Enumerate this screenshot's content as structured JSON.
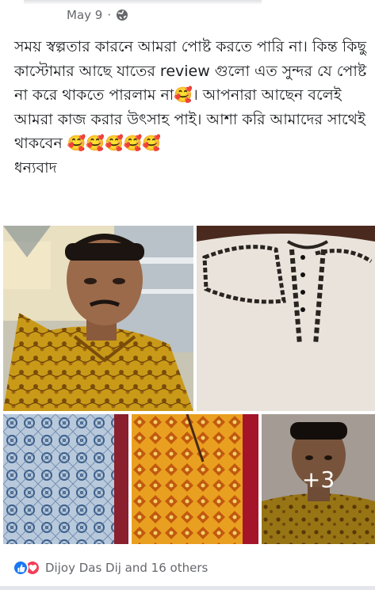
{
  "post": {
    "timestamp": "May 9",
    "separator": "·",
    "privacy_icon": "globe-icon",
    "text": "সময় স্বল্পতার কারনে আমরা পোষ্ট করতে পারি না। কিন্ত কিছু কাস্টোমার আছে যাতের review গুলো এত সুন্দর যে পোষ্ট না করে থাকতে পারলাম না🥰। আপনারা আছেন বলেই আমরা কাজ করার উৎসাহ পাই। আশা করি আমাদের সাথেই থাকবেন 🥰🥰🥰🥰🥰\nধন্যবাদ"
  },
  "photos": {
    "more_count": "+3"
  },
  "reactions": {
    "icons": [
      "like-icon",
      "love-icon"
    ],
    "summary": "Dijoy Das Dij and 16 others"
  },
  "colors": {
    "meta_gray": "#65676b",
    "like_blue": "#1877f2",
    "love_red": "#f33e58"
  }
}
